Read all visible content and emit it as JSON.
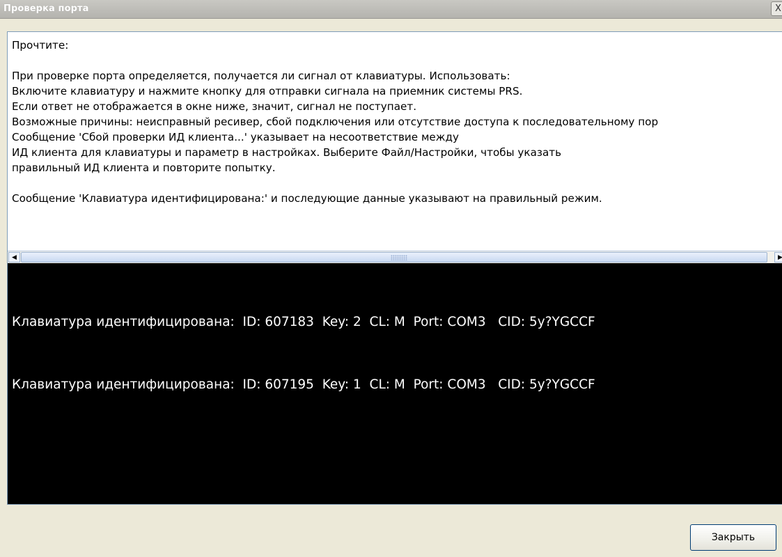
{
  "window": {
    "title": "Проверка порта",
    "close_glyph": "X"
  },
  "instructions": {
    "lines": [
      "Прочтите:",
      "",
      "При проверке порта определяется, получается ли сигнал от клавиатуры. Использовать:",
      "Включите клавиатуру и нажмите кнопку для отправки сигнала на приемник системы PRS.",
      "Если ответ не отображается в окне ниже, значит, сигнал не поступает.",
      "Возможные причины: неисправный ресивер, сбой подключения или отсутствие доступа к последовательному пор",
      "Сообщение 'Сбой проверки ИД клиента...' указывает на несоответствие между",
      "ИД клиента для клавиатуры и параметр в настройках. Выберите Файл/Настройки, чтобы указать",
      "правильный ИД клиента и повторите попытку.",
      "",
      "Сообщение 'Клавиатура идентифицирована:' и последующие данные указывают на правильный режим."
    ]
  },
  "scrollbar": {
    "left_arrow": "◀",
    "right_arrow": "▶"
  },
  "console": {
    "lines": [
      "Клавиатура идентифицирована:  ID: 607183  Key: 2  CL: M  Port: COM3   CID: 5y?YGCCF",
      "Клавиатура идентифицирована:  ID: 607195  Key: 1  CL: M  Port: COM3   CID: 5y?YGCCF"
    ]
  },
  "buttons": {
    "close_label": "Закрыть"
  }
}
